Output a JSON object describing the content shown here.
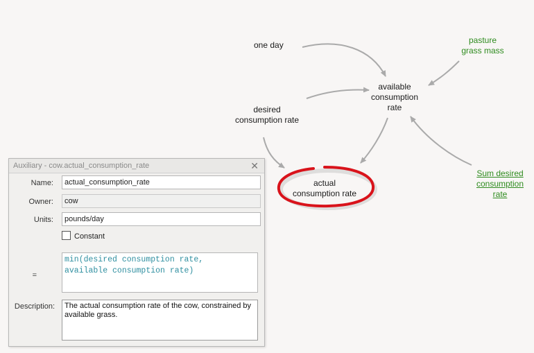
{
  "diagram": {
    "one_day": "one day",
    "pasture_grass_mass": [
      "pasture",
      "grass mass"
    ],
    "available_consumption_rate": [
      "available",
      "consumption",
      "rate"
    ],
    "desired_consumption_rate": [
      "desired",
      "consumption rate"
    ],
    "actual_consumption_rate": [
      "actual",
      "consumption rate"
    ],
    "sum_desired_consumption_rate": [
      "Sum desired",
      "consumption",
      "rate"
    ]
  },
  "dialog": {
    "title": "Auxiliary - cow.actual_consumption_rate",
    "close_glyph": "✕",
    "name_label": "Name:",
    "name_value": "actual_consumption_rate",
    "owner_label": "Owner:",
    "owner_value": "cow",
    "units_label": "Units:",
    "units_value": "pounds/day",
    "constant_label": "Constant",
    "constant_checked": false,
    "equation_label": "=",
    "equation_line1": "min(desired consumption rate,",
    "equation_line2": "available consumption rate)",
    "description_label": "Description:",
    "description_value": "The actual consumption rate of the cow, constrained by available grass."
  },
  "colors": {
    "background": "#f8f6f5",
    "green_text": "#2e8b1e",
    "highlight_red": "#d9131b",
    "arrow_gray": "#aaaaaa",
    "equation_text": "#2f8fa0"
  },
  "icons": {
    "close": "close-icon",
    "checkbox": "checkbox-icon"
  }
}
